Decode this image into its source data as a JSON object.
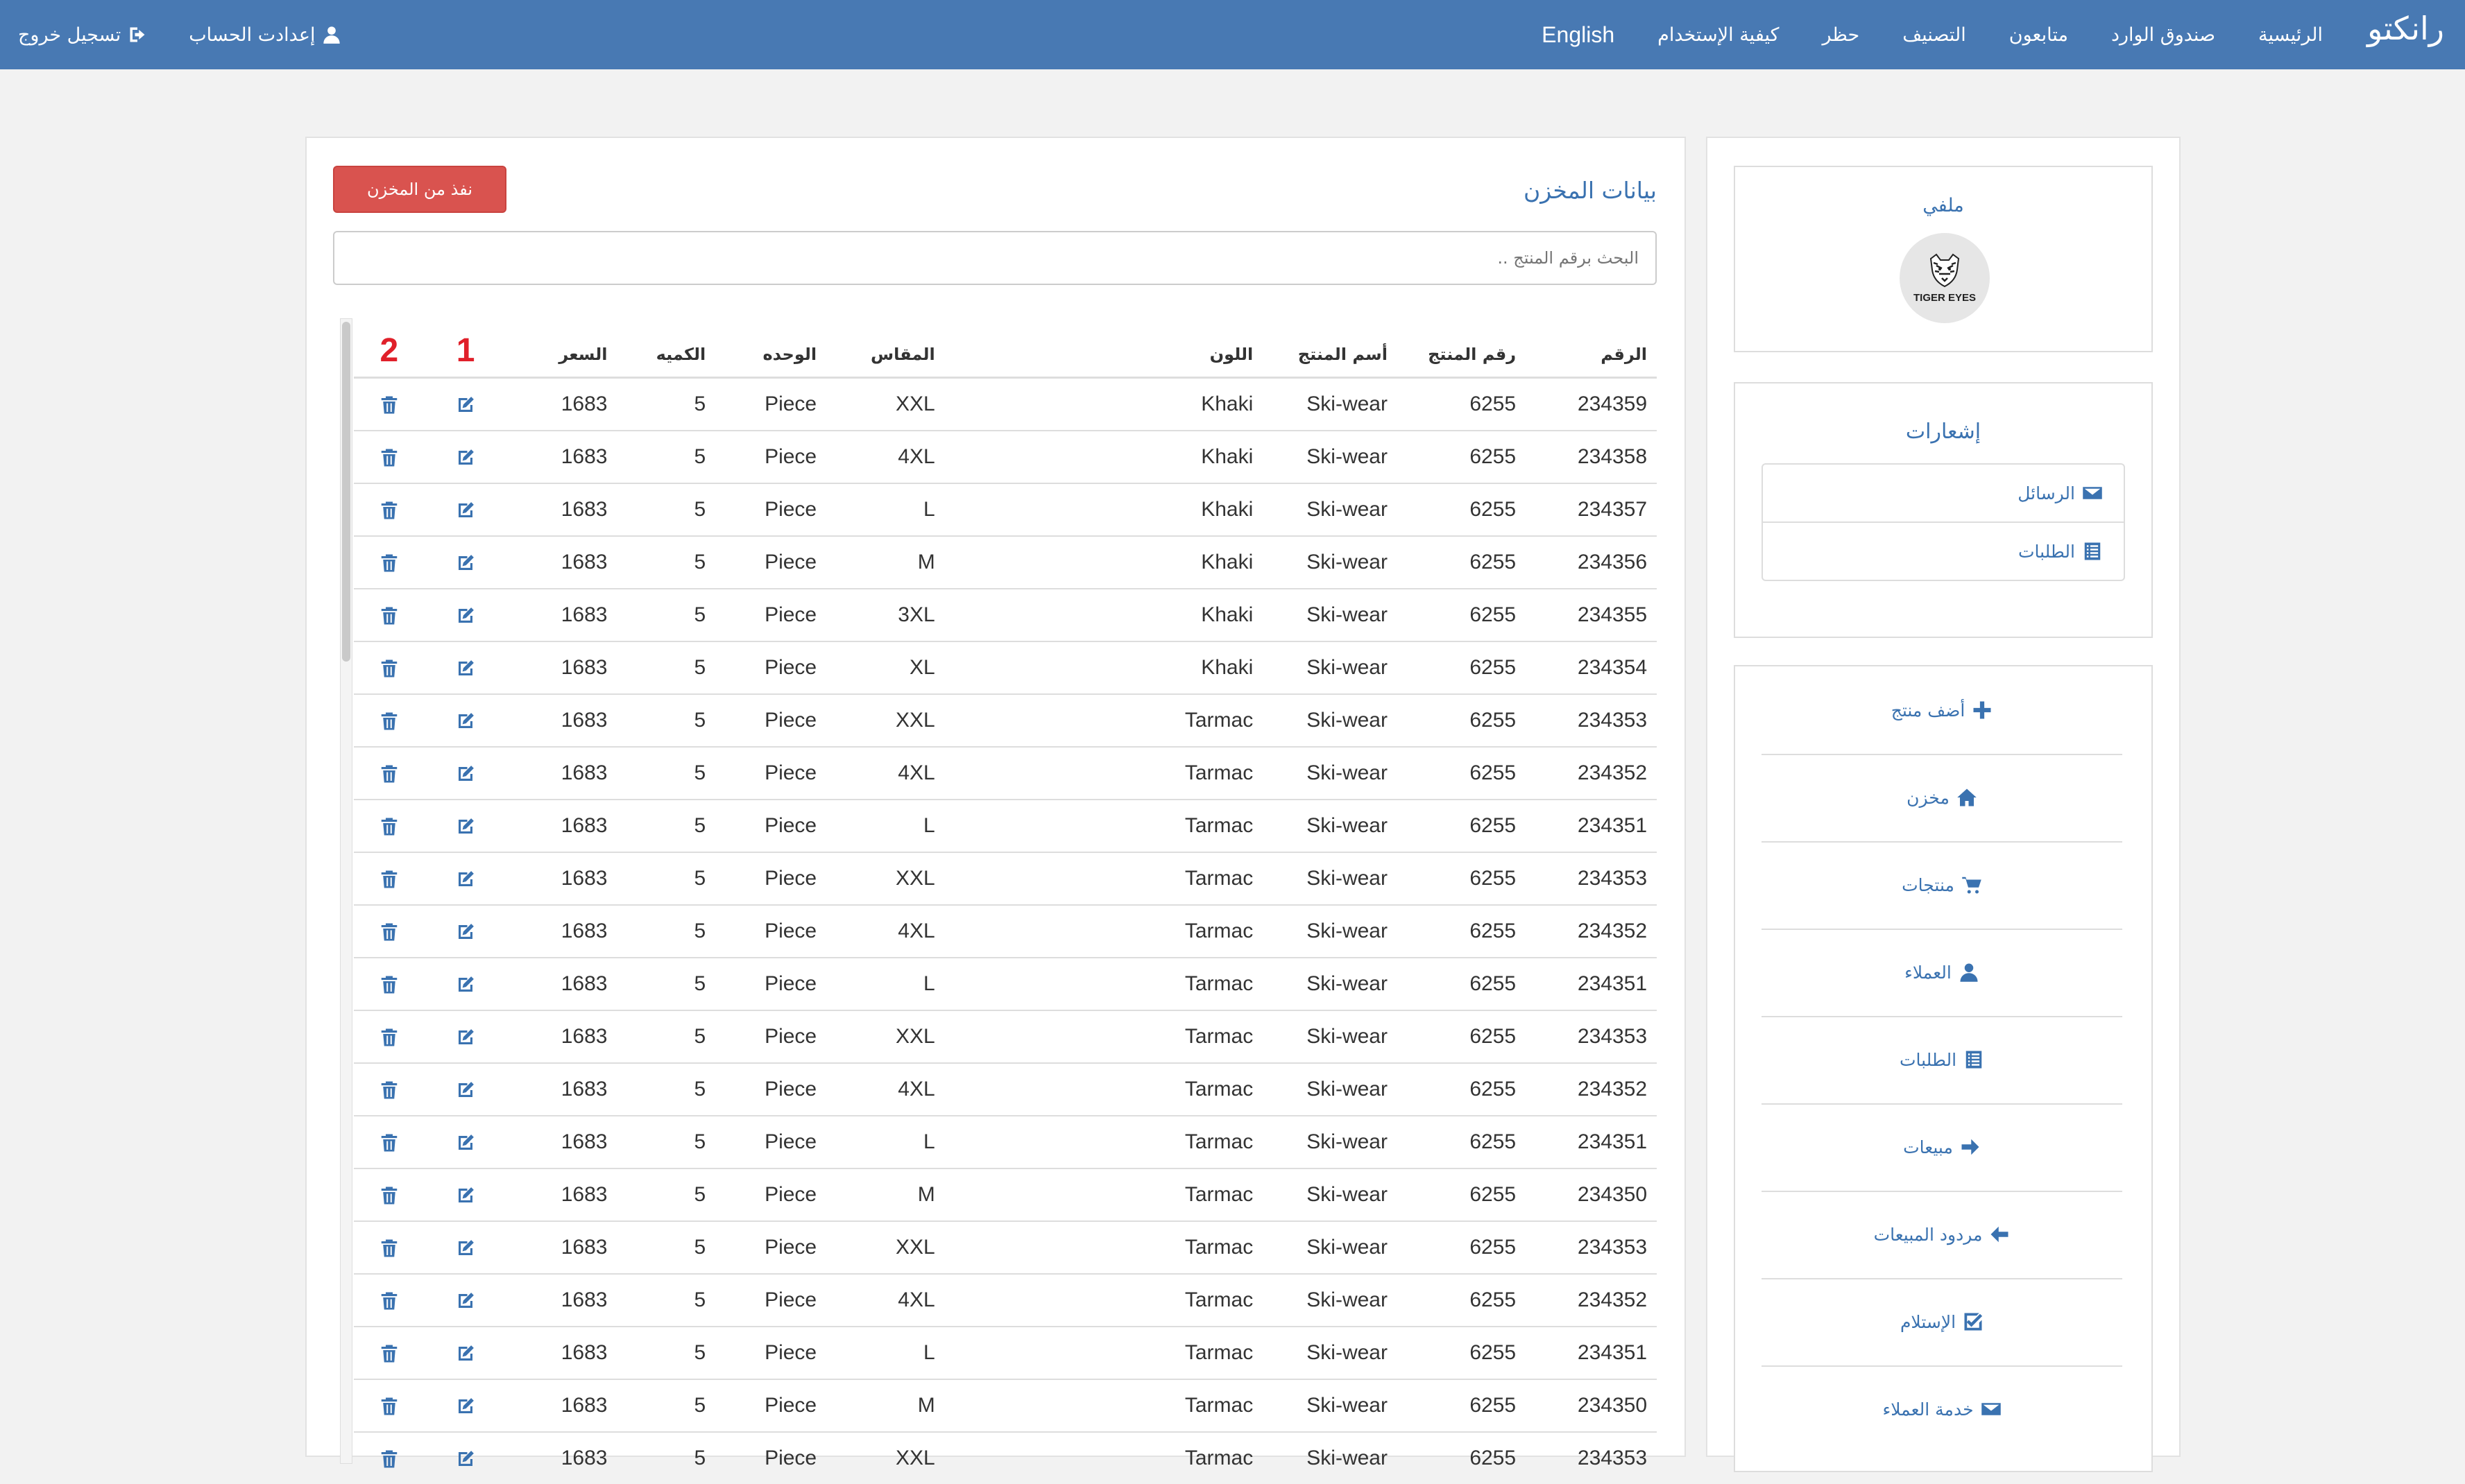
{
  "nav": {
    "brand": "رانكتو",
    "items": [
      "الرئيسية",
      "صندوق الوارد",
      "متابعون",
      "التصنيف",
      "حظر",
      "كيفية الإستخدام"
    ],
    "language": "English",
    "account_settings": "إعدادت الحساب",
    "logout": "تسجيل خروج"
  },
  "main": {
    "title": "بيانات المخزن",
    "out_of_stock_button": "نفذ من المخزن",
    "search_placeholder": "البحث برقم المنتج ..",
    "columns": [
      "الرقم",
      "رقم المنتج",
      "أسم المنتج",
      "اللون",
      "المقاس",
      "الوحده",
      "الكميه",
      "السعر",
      "1",
      "2"
    ],
    "rows": [
      [
        "234359",
        "6255",
        "Ski-wear",
        "Khaki",
        "XXL",
        "Piece",
        "5",
        "1683"
      ],
      [
        "234358",
        "6255",
        "Ski-wear",
        "Khaki",
        "4XL",
        "Piece",
        "5",
        "1683"
      ],
      [
        "234357",
        "6255",
        "Ski-wear",
        "Khaki",
        "L",
        "Piece",
        "5",
        "1683"
      ],
      [
        "234356",
        "6255",
        "Ski-wear",
        "Khaki",
        "M",
        "Piece",
        "5",
        "1683"
      ],
      [
        "234355",
        "6255",
        "Ski-wear",
        "Khaki",
        "3XL",
        "Piece",
        "5",
        "1683"
      ],
      [
        "234354",
        "6255",
        "Ski-wear",
        "Khaki",
        "XL",
        "Piece",
        "5",
        "1683"
      ],
      [
        "234353",
        "6255",
        "Ski-wear",
        "Tarmac",
        "XXL",
        "Piece",
        "5",
        "1683"
      ],
      [
        "234352",
        "6255",
        "Ski-wear",
        "Tarmac",
        "4XL",
        "Piece",
        "5",
        "1683"
      ],
      [
        "234351",
        "6255",
        "Ski-wear",
        "Tarmac",
        "L",
        "Piece",
        "5",
        "1683"
      ],
      [
        "234353",
        "6255",
        "Ski-wear",
        "Tarmac",
        "XXL",
        "Piece",
        "5",
        "1683"
      ],
      [
        "234352",
        "6255",
        "Ski-wear",
        "Tarmac",
        "4XL",
        "Piece",
        "5",
        "1683"
      ],
      [
        "234351",
        "6255",
        "Ski-wear",
        "Tarmac",
        "L",
        "Piece",
        "5",
        "1683"
      ],
      [
        "234353",
        "6255",
        "Ski-wear",
        "Tarmac",
        "XXL",
        "Piece",
        "5",
        "1683"
      ],
      [
        "234352",
        "6255",
        "Ski-wear",
        "Tarmac",
        "4XL",
        "Piece",
        "5",
        "1683"
      ],
      [
        "234351",
        "6255",
        "Ski-wear",
        "Tarmac",
        "L",
        "Piece",
        "5",
        "1683"
      ],
      [
        "234350",
        "6255",
        "Ski-wear",
        "Tarmac",
        "M",
        "Piece",
        "5",
        "1683"
      ],
      [
        "234353",
        "6255",
        "Ski-wear",
        "Tarmac",
        "XXL",
        "Piece",
        "5",
        "1683"
      ],
      [
        "234352",
        "6255",
        "Ski-wear",
        "Tarmac",
        "4XL",
        "Piece",
        "5",
        "1683"
      ],
      [
        "234351",
        "6255",
        "Ski-wear",
        "Tarmac",
        "L",
        "Piece",
        "5",
        "1683"
      ],
      [
        "234350",
        "6255",
        "Ski-wear",
        "Tarmac",
        "M",
        "Piece",
        "5",
        "1683"
      ],
      [
        "234353",
        "6255",
        "Ski-wear",
        "Tarmac",
        "XXL",
        "Piece",
        "5",
        "1683"
      ]
    ]
  },
  "sidebar": {
    "profile_title": "ملفي",
    "profile_logo_text": "TIGER EYES",
    "notifications_title": "إشعارات",
    "notifications": [
      {
        "label": "الرسائل",
        "icon": "envelope-icon"
      },
      {
        "label": "الطلبات",
        "icon": "list-icon"
      }
    ],
    "menu": [
      {
        "label": "أضف منتج",
        "icon": "plus-icon"
      },
      {
        "label": "مخزن",
        "icon": "home-icon"
      },
      {
        "label": "منتجات",
        "icon": "cart-icon"
      },
      {
        "label": "العملاء",
        "icon": "user-icon"
      },
      {
        "label": "الطلبات",
        "icon": "list-icon"
      },
      {
        "label": "مبيعات",
        "icon": "arrow-right-icon"
      },
      {
        "label": "مردود المبيعات",
        "icon": "arrow-left-icon"
      },
      {
        "label": "الإستلام",
        "icon": "check-square-icon"
      },
      {
        "label": "خدمة العملاء",
        "icon": "envelope-icon"
      }
    ]
  },
  "colors": {
    "navbar": "#4879b3",
    "accent": "#3a72b0",
    "danger": "#d9534f",
    "column_numbers": "#e0202a"
  }
}
